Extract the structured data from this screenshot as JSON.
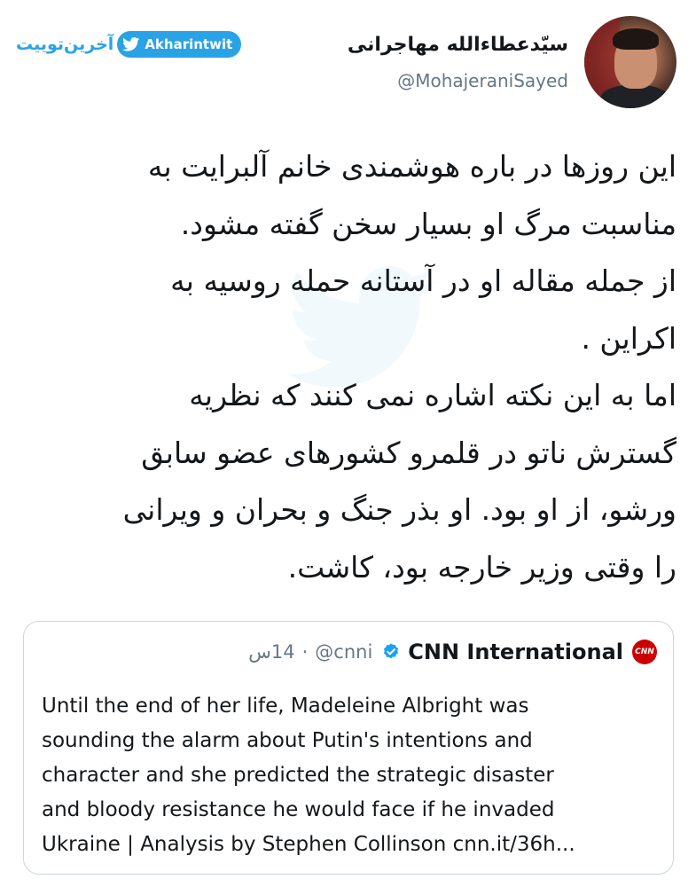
{
  "brand": {
    "persian_name": "آخرین‌توییت",
    "latin_name": "Akharintwit",
    "color": "#29a3e6",
    "icon": "twitter-bird-icon"
  },
  "author": {
    "name": "سیّدعطاءالله مهاجرانی",
    "handle": "@MohajeraniSayed",
    "avatar_icon": "avatar"
  },
  "tweet": {
    "lines": [
      "این روزها در باره هوشمندی خانم آلبرایت به",
      "مناسبت مرگ او بسیار سخن گفته مشود.",
      "از جمله مقاله او در آستانه حمله روسیه به",
      "اکراین .",
      "اما به این نکته اشاره نمی کنند که نظریه",
      "گسترش ناتو در قلمرو کشورهای عضو سابق",
      "ورشو، از او بود. او بذر جنگ و بحران و ویرانی",
      "را وقتی وزیر خارجه بود، کاشت."
    ]
  },
  "quote": {
    "logo_text": "CNN",
    "name": "CNN International",
    "verified": true,
    "handle": "@cnni",
    "separator": "·",
    "time": "14س",
    "text_lines": [
      "Until the end of her life, Madeleine Albright was",
      "sounding the alarm about Putin's intentions and",
      "character and she predicted the strategic disaster",
      "and bloody resistance he would face if he invaded",
      "Ukraine | Analysis by Stephen Collinson cnn.it/36h..."
    ],
    "accent_color": "#cc0000",
    "verified_color": "#1da1f2"
  }
}
